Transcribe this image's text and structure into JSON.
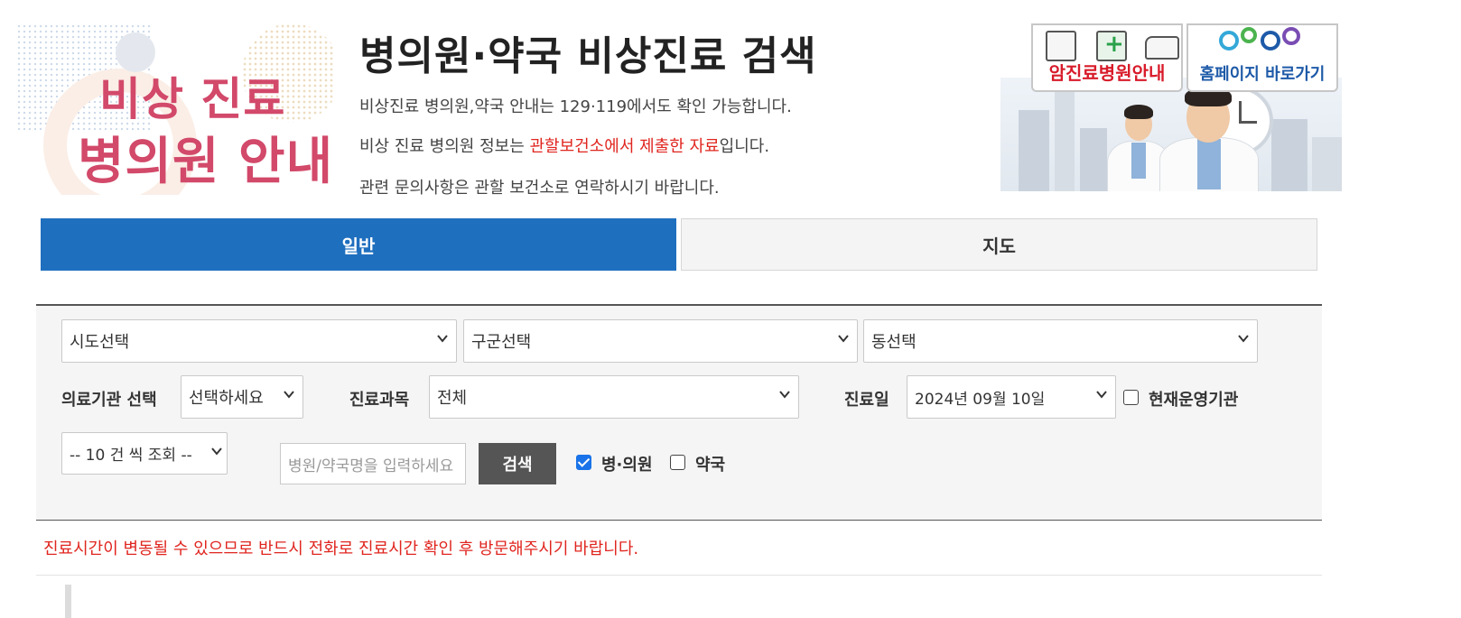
{
  "banner": {
    "left_line1": "비상 진료",
    "left_line2": "병의원 안내",
    "title": "병의원·약국 비상진료 검색",
    "intro1": "비상진료 병의원,약국 안내는 129·119에서도 확인 가능합니다.",
    "intro2_a": "비상 진료 병의원 정보는 ",
    "intro2_red": "관할보건소에서 제출한 자료",
    "intro2_b": "입니다.",
    "intro3": "관련 문의사항은 관할 보건소로 연락하시기 바랍니다.",
    "card_cancer": "암진료병원안내",
    "card_home": "홈페이지 바로가기"
  },
  "tabs": [
    {
      "label": "일반",
      "active": true
    },
    {
      "label": "지도",
      "active": false
    }
  ],
  "filters": {
    "sido": "시도선택",
    "gugun": "구군선택",
    "dong": "동선택",
    "inst_label": "의료기관 선택",
    "inst_value": "선택하세요",
    "dept_label": "진료과목",
    "dept_value": "전체",
    "date_label": "진료일",
    "date_value": "2024년 09월 10일",
    "open_now_label": "현재운영기관",
    "open_now_checked": false,
    "per_page": "-- 10 건 씩 조회 --",
    "name_placeholder": "병원/약국명을 입력하세요",
    "search_button": "검색",
    "hospital_label": "병·의원",
    "hospital_checked": true,
    "pharmacy_label": "약국",
    "pharmacy_checked": false
  },
  "notice": "진료시간이 변동될 수 있으므로 반드시 전화로 진료시간 확인 후 방문해주시기 바랍니다.",
  "colors": {
    "tab_active": "#1f6fbf",
    "banner_pink": "#d2496a",
    "notice_red": "#e0251f"
  }
}
